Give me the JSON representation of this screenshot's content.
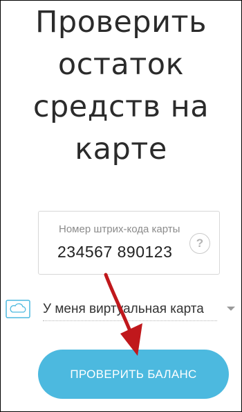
{
  "page": {
    "title_lines": [
      "Проверить",
      "остаток",
      "средств на",
      "карте"
    ]
  },
  "barcode": {
    "label": "Номер штрих-кода карты",
    "value": "234567 890123",
    "help_symbol": "?"
  },
  "card_type": {
    "selected": "У меня виртуальная карта",
    "icon": "cloud-card-icon"
  },
  "check_button": {
    "label": "ПРОВЕРИТЬ БАЛАНС"
  },
  "colors": {
    "accent": "#4cb9df",
    "arrow": "#c0181c"
  }
}
